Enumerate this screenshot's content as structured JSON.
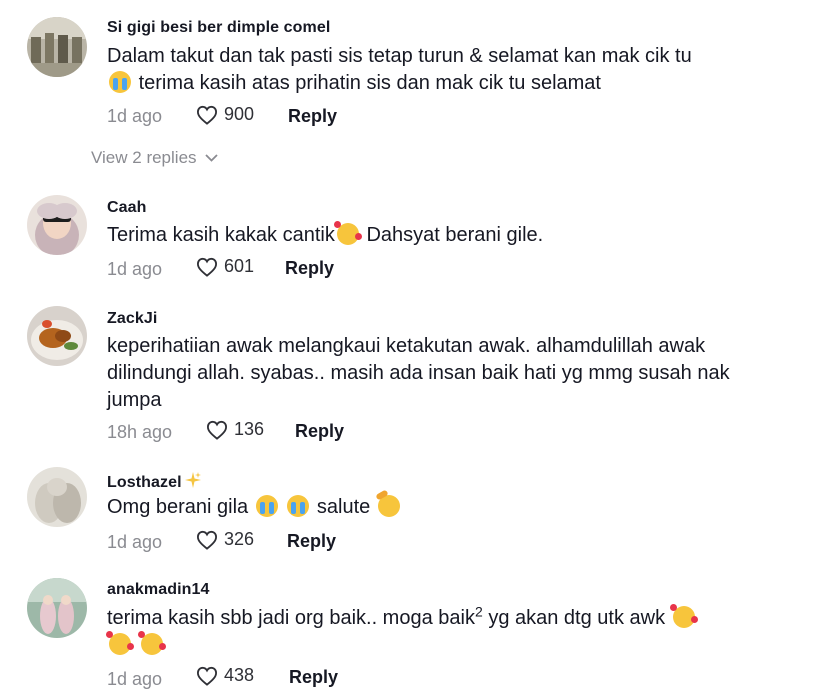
{
  "comments": [
    {
      "username": "Si gigi besi ber dimple comel",
      "text_line1": "Dalam takut dan tak pasti sis tetap turun & selamat kan mak cik tu",
      "text_line2": "terima kasih atas prihatin sis dan mak cik tu selamat",
      "time": "1d ago",
      "likes": "900",
      "reply": "Reply"
    },
    {
      "username": "Caah",
      "text_a": "Terima kasih kakak cantik",
      "text_b": "Dahsyat berani gile.",
      "time": "1d ago",
      "likes": "601",
      "reply": "Reply"
    },
    {
      "username": "ZackJi",
      "text": "keperihatiian awak melangkaui ketakutan awak. alhamdulillah awak dilindungi allah. syabas.. masih ada insan baik hati yg mmg susah nak jumpa",
      "time": "18h ago",
      "likes": "136",
      "reply": "Reply"
    },
    {
      "username": "Losthazel",
      "text_a": "Omg berani gila",
      "text_b": "salute",
      "time": "1d ago",
      "likes": "326",
      "reply": "Reply"
    },
    {
      "username": "anakmadin14",
      "text_a": "terima kasih sbb jadi org baik.. moga baik",
      "text_sup": "2",
      "text_b": "yg akan dtg utk awk",
      "time": "1d ago",
      "likes": "438",
      "reply": "Reply"
    }
  ],
  "view_replies": "View 2 replies",
  "icons": {
    "like": "heart-outline-icon",
    "expand": "chevron-down-icon",
    "emoji_cry": "loudly-crying-face-emoji",
    "emoji_love": "smiling-face-with-hearts-emoji",
    "emoji_salute": "saluting-face-emoji",
    "sparkle": "sparkles-emoji"
  },
  "colors": {
    "text": "#161823",
    "muted": "#8a8b91"
  }
}
